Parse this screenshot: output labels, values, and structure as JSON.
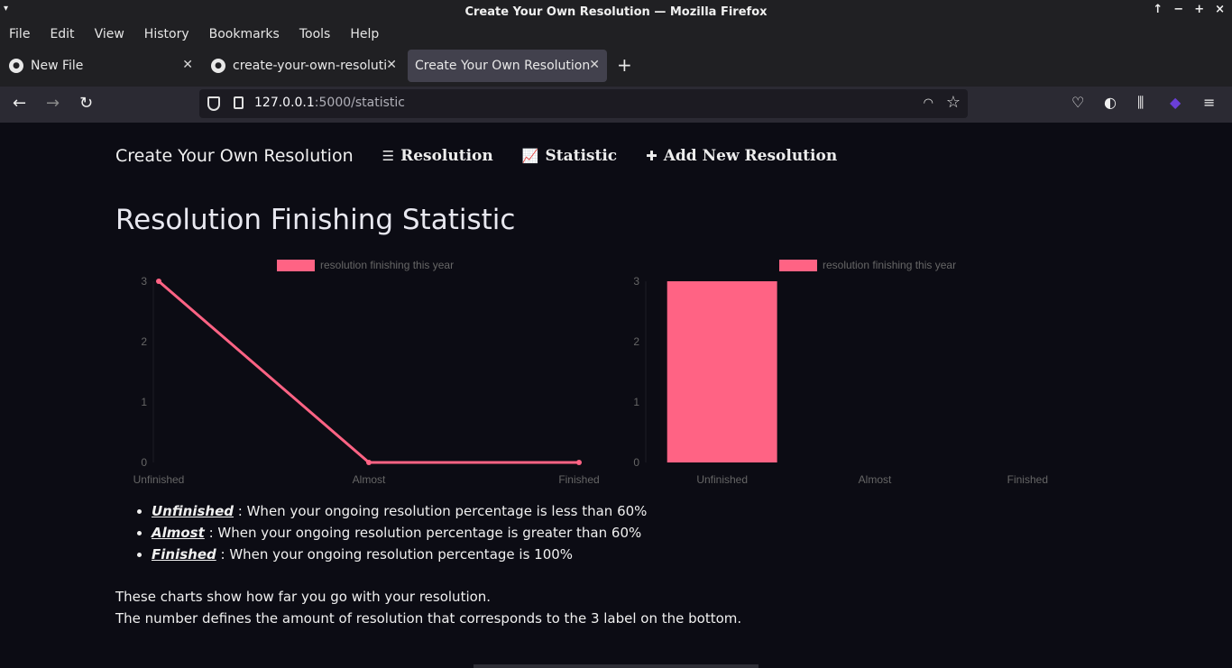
{
  "window": {
    "title": "Create Your Own Resolution — Mozilla Firefox",
    "controls": [
      "↑",
      "−",
      "+",
      "×"
    ]
  },
  "menu": [
    "File",
    "Edit",
    "View",
    "History",
    "Bookmarks",
    "Tools",
    "Help"
  ],
  "tabs": [
    {
      "label": "New File",
      "icon": "github-icon",
      "active": false
    },
    {
      "label": "create-your-own-resoluti",
      "icon": "github-icon",
      "active": false
    },
    {
      "label": "Create Your Own Resolution",
      "icon": "",
      "active": true
    }
  ],
  "address": {
    "host": "127.0.0.1",
    "path": ":5000/statistic"
  },
  "site_nav": {
    "brand": "Create Your Own Resolution",
    "links": [
      {
        "label": "Resolution",
        "icon": "list-icon"
      },
      {
        "label": "Statistic",
        "icon": "chart-line-icon"
      },
      {
        "label": "Add New Resolution",
        "icon": "plus-icon"
      }
    ]
  },
  "page": {
    "heading": "Resolution Finishing Statistic",
    "definitions": [
      {
        "term": "Unfinished",
        "text": " : When your ongoing resolution percentage is less than 60%"
      },
      {
        "term": "Almost",
        "text": " : When your ongoing resolution percentage is greater than 60%"
      },
      {
        "term": "Finished",
        "text": " : When your ongoing resolution percentage is 100%"
      }
    ],
    "paragraph_lines": [
      "These charts show how far you go with your resolution.",
      "The number defines the amount of resolution that corresponds to the 3 label on the bottom."
    ]
  },
  "chart_data": [
    {
      "type": "line",
      "categories": [
        "Unfinished",
        "Almost",
        "Finished"
      ],
      "series": [
        {
          "name": "resolution finishing this year",
          "values": [
            3,
            0,
            0
          ]
        }
      ],
      "yticks": [
        0,
        1,
        2,
        3
      ],
      "ylim": [
        0,
        3
      ],
      "color": "#ff6384",
      "legend": "top"
    },
    {
      "type": "bar",
      "categories": [
        "Unfinished",
        "Almost",
        "Finished"
      ],
      "series": [
        {
          "name": "resolution finishing this year",
          "values": [
            3,
            0,
            0
          ]
        }
      ],
      "yticks": [
        0,
        1,
        2,
        3
      ],
      "ylim": [
        0,
        3
      ],
      "color": "#ff6384",
      "legend": "top"
    }
  ]
}
